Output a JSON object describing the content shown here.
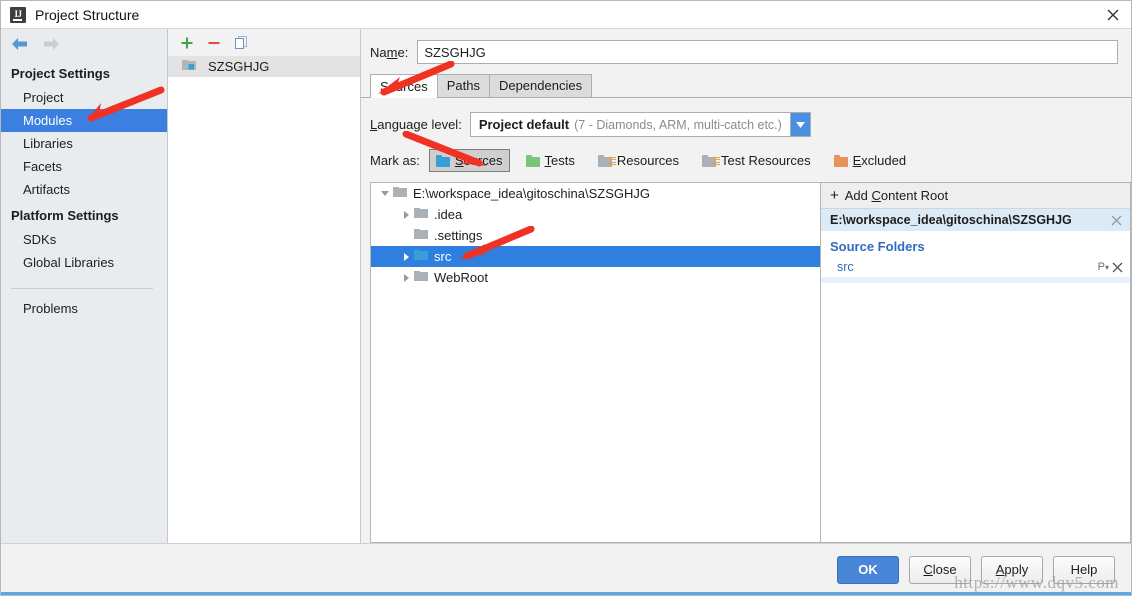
{
  "window": {
    "title": "Project Structure",
    "logo_text": "IJ",
    "close_icon": "close-icon"
  },
  "sidebar": {
    "nav": {
      "back_icon": "arrow-left-icon",
      "forward_icon": "arrow-right-icon"
    },
    "groups": [
      {
        "title": "Project Settings",
        "items": [
          {
            "label": "Project",
            "selected": false
          },
          {
            "label": "Modules",
            "selected": true
          },
          {
            "label": "Libraries",
            "selected": false
          },
          {
            "label": "Facets",
            "selected": false
          },
          {
            "label": "Artifacts",
            "selected": false
          }
        ]
      },
      {
        "title": "Platform Settings",
        "items": [
          {
            "label": "SDKs",
            "selected": false
          },
          {
            "label": "Global Libraries",
            "selected": false
          }
        ]
      }
    ],
    "problems_label": "Problems"
  },
  "modules_pane": {
    "toolbar": {
      "add_icon": "plus-icon",
      "remove_icon": "minus-icon",
      "copy_icon": "copy-icon"
    },
    "modules": [
      {
        "name": "SZSGHJG",
        "icon": "module-folder-icon",
        "selected": true
      }
    ]
  },
  "detail": {
    "name_label": "Name:",
    "name_label_mnemonic": "m",
    "name_value": "SZSGHJG",
    "tabs": [
      {
        "label": "Sources",
        "active": true
      },
      {
        "label": "Paths",
        "active": false
      },
      {
        "label": "Dependencies",
        "active": false
      }
    ],
    "language_level": {
      "label": "Language level:",
      "value_primary": "Project default",
      "value_secondary": "(7 - Diamonds, ARM, multi-catch etc.)",
      "dropdown_icon": "chevron-down-icon"
    },
    "mark_as": {
      "label": "Mark as:",
      "options": [
        {
          "label": "Sources",
          "color": "#389fd6",
          "style": "f-blue",
          "selected": true,
          "lines": false
        },
        {
          "label": "Tests",
          "color": "#7cc47c",
          "style": "f-green",
          "selected": false,
          "lines": false
        },
        {
          "label": "Resources",
          "color": "#a9b0b6",
          "style": "f-gray",
          "selected": false,
          "lines": true
        },
        {
          "label": "Test Resources",
          "color": "#a9b0b6",
          "style": "f-gray",
          "selected": false,
          "lines": true
        },
        {
          "label": "Excluded",
          "color": "#e8935c",
          "style": "f-orange",
          "selected": false,
          "lines": false
        }
      ]
    },
    "tree": [
      {
        "label": "E:\\workspace_idea\\gitoschina\\SZSGHJG",
        "depth": 0,
        "twisty": "open",
        "folder": "gray",
        "selected": false
      },
      {
        "label": ".idea",
        "depth": 1,
        "twisty": "closed",
        "folder": "gray",
        "selected": false
      },
      {
        "label": ".settings",
        "depth": 1,
        "twisty": "none",
        "folder": "gray",
        "selected": false
      },
      {
        "label": "src",
        "depth": 1,
        "twisty": "closed",
        "folder": "blue",
        "selected": true
      },
      {
        "label": "WebRoot",
        "depth": 1,
        "twisty": "closed",
        "folder": "gray",
        "selected": false
      }
    ],
    "right_panel": {
      "add_content_root": "Add Content Root",
      "add_content_root_mnemonic": "C",
      "content_root_path": "E:\\workspace_idea\\gitoschina\\SZSGHJG",
      "source_folders_header": "Source Folders",
      "source_folders": [
        {
          "name": "src",
          "package_prefix_icon": "package-prefix-icon",
          "remove_icon": "close-icon"
        }
      ],
      "remove_root_icon": "close-icon"
    }
  },
  "footer": {
    "buttons": [
      {
        "label": "OK",
        "primary": true,
        "mnemonic": ""
      },
      {
        "label": "Close",
        "primary": false,
        "mnemonic": "C"
      },
      {
        "label": "Apply",
        "primary": false,
        "mnemonic": "A"
      },
      {
        "label": "Help",
        "primary": false,
        "mnemonic": ""
      }
    ],
    "watermark": "https://www.dqv5.com"
  },
  "colors": {
    "selection_blue": "#3b7fe0",
    "tree_selection_blue": "#2f7fe0",
    "accent_blue": "#4a86d8",
    "annotation_red": "#ef3224",
    "link_blue": "#2f6cc0"
  }
}
